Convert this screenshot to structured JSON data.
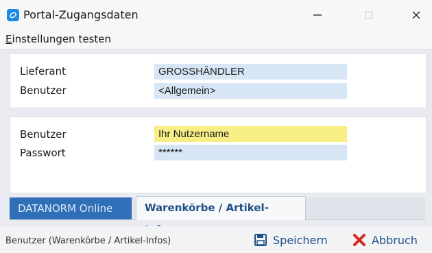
{
  "window": {
    "title": "Portal-Zugangsdaten",
    "controls": {
      "minimize": "—",
      "maximize": "☐",
      "close": "✕"
    }
  },
  "menu": {
    "items": [
      {
        "first": "E",
        "rest": "instellungen testen"
      }
    ]
  },
  "supplier_section": {
    "lieferant_label": "Lieferant",
    "lieferant_value": "GROSSHÄNDLER",
    "benutzer_label": "Benutzer",
    "benutzer_value": "<Allgemein>"
  },
  "credentials_section": {
    "benutzer_label": "Benutzer",
    "benutzer_value": "Ihr Nutzername",
    "passwort_label": "Passwort",
    "passwort_value": "******"
  },
  "tabs": [
    {
      "label": "DATANORM Online",
      "active": false
    },
    {
      "label": "Warenkörbe / Artikel-Infos",
      "active": true
    }
  ],
  "status": {
    "text": "Benutzer (Warenkörbe / Artikel-Infos)",
    "save_label": "Speichern",
    "cancel_label": "Abbruch"
  },
  "colors": {
    "accent": "#1f4f86",
    "field_bg": "#d6e6f4",
    "active_field_bg": "#f7ee86",
    "cancel_red": "#d9261c"
  },
  "icons": {
    "app": "portal-app-icon",
    "save": "floppy-disk-icon",
    "cancel": "red-x-icon"
  }
}
